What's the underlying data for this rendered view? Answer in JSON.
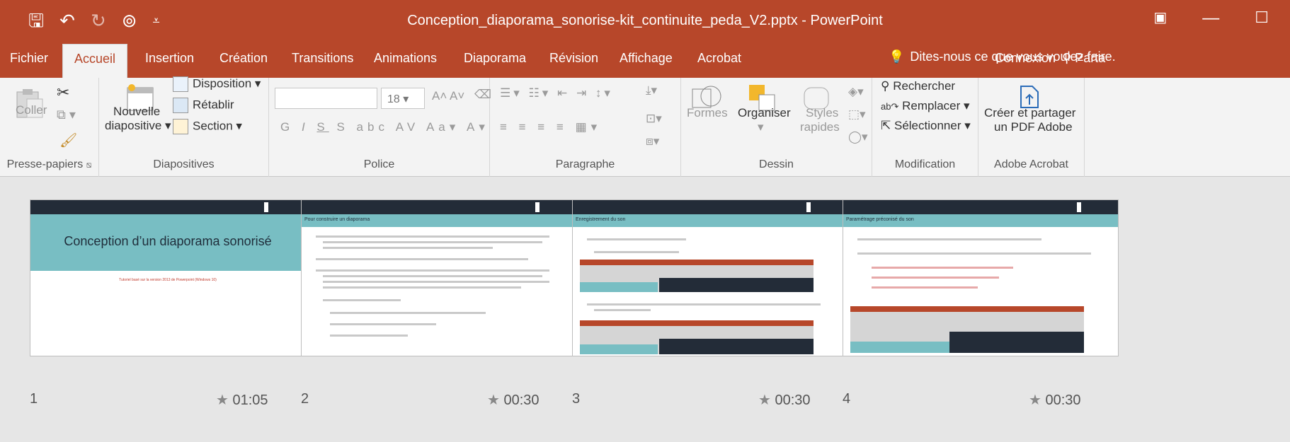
{
  "window": {
    "title": "Conception_diaporama_sonorise-kit_continuite_peda_V2.pptx - PowerPoint"
  },
  "tabs": [
    "Fichier",
    "Accueil",
    "Insertion",
    "Création",
    "Transitions",
    "Animations",
    "Diaporama",
    "Révision",
    "Affichage",
    "Acrobat"
  ],
  "tell_me": "Dites-nous ce que vous voulez faire.",
  "account": {
    "connexion": "Connexion",
    "share": "Parta"
  },
  "ribbon": {
    "clipboard": {
      "coller": "Coller",
      "label": "Presse-papiers"
    },
    "slides": {
      "nouvelle": "Nouvelle",
      "diapositive": "diapositive",
      "disposition": "Disposition",
      "retablir": "Rétablir",
      "section": "Section",
      "label": "Diapositives"
    },
    "font": {
      "size": "18",
      "label": "Police"
    },
    "paragraph": {
      "label": "Paragraphe"
    },
    "drawing": {
      "formes": "Formes",
      "organiser": "Organiser",
      "styles": "Styles",
      "rapides": "rapides",
      "label": "Dessin"
    },
    "editing": {
      "rechercher": "Rechercher",
      "remplacer": "Remplacer",
      "selectionner": "Sélectionner",
      "label": "Modification"
    },
    "acrobat": {
      "line1": "Créer et partager",
      "line2": "un PDF Adobe",
      "label": "Adobe Acrobat"
    }
  },
  "slides": [
    {
      "number": "1",
      "time": "01:05",
      "title": "Conception d’un diaporama sonorisé",
      "subtitle": "Tutoriel basé sur la version 2013 de Powerpoint (Windows 10)"
    },
    {
      "number": "2",
      "time": "00:30",
      "title": "Pour construire un diaporama"
    },
    {
      "number": "3",
      "time": "00:30",
      "title": "Enregistrement du son"
    },
    {
      "number": "4",
      "time": "00:30",
      "title": "Paramétrage préconisé du son"
    }
  ],
  "colors": {
    "accent": "#b7472a",
    "teal": "#78bec3",
    "dark_bar": "#232c38"
  }
}
